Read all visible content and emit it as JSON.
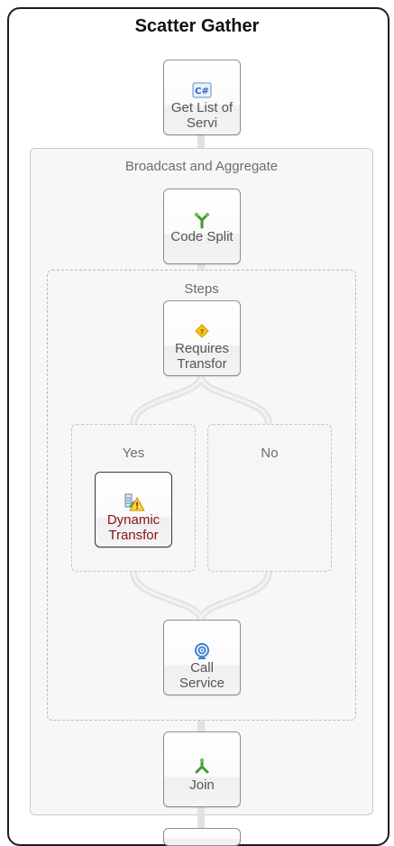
{
  "diagram": {
    "title": "Scatter Gather",
    "nodes": {
      "get_list": {
        "label": "Get List of Servi",
        "icon": "csharp-icon"
      },
      "code_split": {
        "label": "Code Split",
        "icon": "split-icon"
      },
      "requires_transform": {
        "label": "Requires Transfor",
        "icon": "decision-icon"
      },
      "dynamic_transform": {
        "label": "Dynamic Transfor",
        "icon": "transform-warning-icon"
      },
      "call_service": {
        "label": "Call Service",
        "icon": "service-icon"
      },
      "join": {
        "label": "Join",
        "icon": "join-icon"
      }
    },
    "groups": {
      "broadcast": {
        "label": "Broadcast and Aggregate"
      },
      "steps": {
        "label": "Steps"
      },
      "yes_branch": {
        "label": "Yes"
      },
      "no_branch": {
        "label": "No"
      }
    },
    "colors": {
      "node_border": "#8f8f8f",
      "warning_text": "#8a1218",
      "connector": "#e2e2e2",
      "group_bg": "#f7f7f7"
    }
  }
}
